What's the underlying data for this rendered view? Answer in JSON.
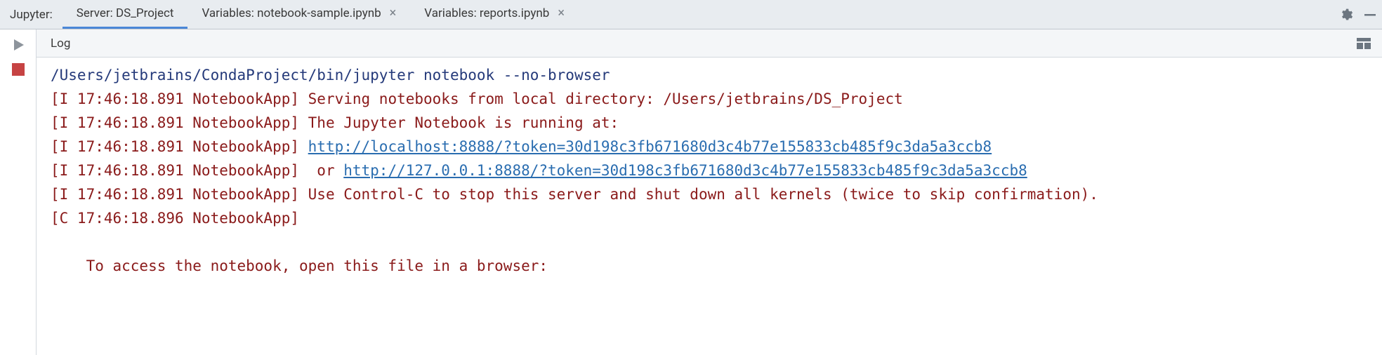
{
  "panel": {
    "name": "Jupyter:"
  },
  "tabs": [
    {
      "label": "Server: DS_Project",
      "closable": false,
      "active": true
    },
    {
      "label": "Variables: notebook-sample.ipynb",
      "closable": true,
      "active": false
    },
    {
      "label": "Variables: reports.ipynb",
      "closable": true,
      "active": false
    }
  ],
  "log": {
    "header": "Log",
    "command": "/Users/jetbrains/CondaProject/bin/jupyter notebook --no-browser",
    "prefix_i": "[I 17:46:18.891 NotebookApp] ",
    "prefix_c": "[C 17:46:18.896 NotebookApp]",
    "line_serving": "Serving notebooks from local directory: /Users/jetbrains/DS_Project",
    "line_running": "The Jupyter Notebook is running at:",
    "url1": "http://localhost:8888/?token=30d198c3fb671680d3c4b77e155833cb485f9c3da5a3ccb8",
    "line_or": " or ",
    "url2": "http://127.0.0.1:8888/?token=30d198c3fb671680d3c4b77e155833cb485f9c3da5a3ccb8",
    "line_ctrlc": "Use Control-C to stop this server and shut down all kernels (twice to skip confirmation).",
    "line_access": "    To access the notebook, open this file in a browser:"
  }
}
